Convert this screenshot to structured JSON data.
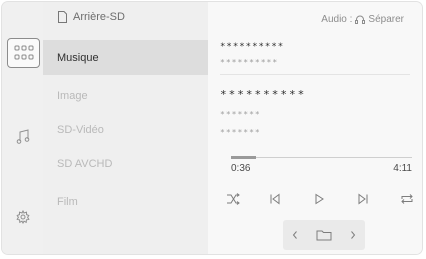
{
  "header": {
    "source_title": "Arrière-SD"
  },
  "audio": {
    "label": "Audio :",
    "mode": "Séparer"
  },
  "sources": [
    {
      "label": "Musique",
      "active": true
    },
    {
      "label": "Image",
      "active": false
    },
    {
      "label": "SD-Vidéo",
      "active": false
    },
    {
      "label": "SD AVCHD",
      "active": false
    },
    {
      "label": "Film",
      "active": false
    }
  ],
  "track": {
    "title": "**********",
    "subtitle": "**********",
    "album": "**********",
    "artist": "*******",
    "genre": "*******"
  },
  "playback": {
    "elapsed": "0:36",
    "total": "4:11",
    "progress": 0.14
  },
  "icons": {
    "apps": "grid-icon",
    "music": "music-note-icon",
    "settings": "gear-icon",
    "shuffle": "shuffle-icon",
    "previous": "skip-previous-icon",
    "play": "play-icon",
    "next": "skip-next-icon",
    "repeat": "repeat-icon",
    "browse_prev": "chevron-left-icon",
    "folder": "folder-icon",
    "browse_next": "chevron-right-icon",
    "headphones": "headphones-icon",
    "sd_card": "sd-card-icon"
  }
}
